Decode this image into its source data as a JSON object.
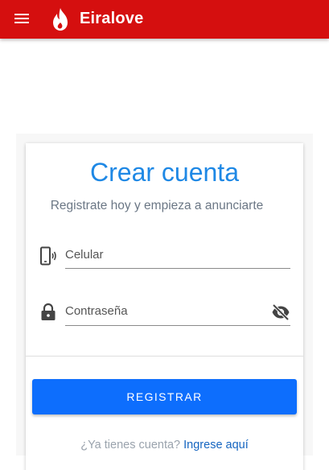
{
  "appbar": {
    "brand": "Eiralove",
    "menu_icon": "menu-icon",
    "logo_icon": "flame-icon",
    "color": "#d50f0f"
  },
  "form": {
    "title": "Crear cuenta",
    "subtitle": "Registrate hoy y empieza a anunciarte",
    "phone": {
      "label": "Celular",
      "value": "",
      "icon": "phone-icon"
    },
    "password": {
      "label": "Contraseña",
      "value": "",
      "icon": "lock-icon",
      "toggle_icon": "eye-off-icon"
    },
    "submit_label": "REGISTRAR",
    "footer_question": "¿Ya tienes cuenta?",
    "footer_link": "Ingrese aquí",
    "accent": "#1e88e5",
    "button_color": "#0d6efd"
  }
}
